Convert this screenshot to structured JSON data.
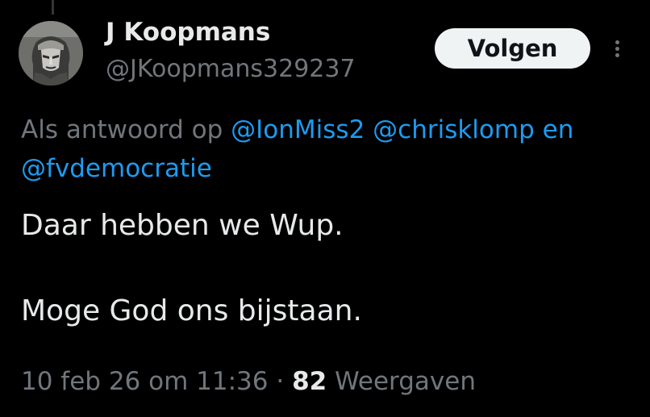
{
  "author": {
    "display_name": "J Koopmans",
    "handle": "@JKoopmans329237",
    "avatar_icon": "bust-statue-avatar"
  },
  "actions": {
    "follow_label": "Volgen",
    "more_icon": "more-vertical-icon"
  },
  "reply_context": {
    "prefix": "Als antwoord op",
    "mentions": [
      "@IonMiss2",
      "@chrisklomp",
      "@fvdemocratie"
    ],
    "conjunction": "en"
  },
  "tweet": {
    "lines": [
      "Daar hebben we Wup.",
      "Moge God ons bijstaan."
    ]
  },
  "meta": {
    "timestamp": "10 feb 26 om 11:36",
    "separator": "·",
    "view_count": "82",
    "view_label": "Weergaven"
  },
  "colors": {
    "background": "#000000",
    "primary_text": "#e7e9ea",
    "secondary_text": "#71767b",
    "link": "#1d9bf0",
    "follow_button_bg": "#eff3f4"
  }
}
